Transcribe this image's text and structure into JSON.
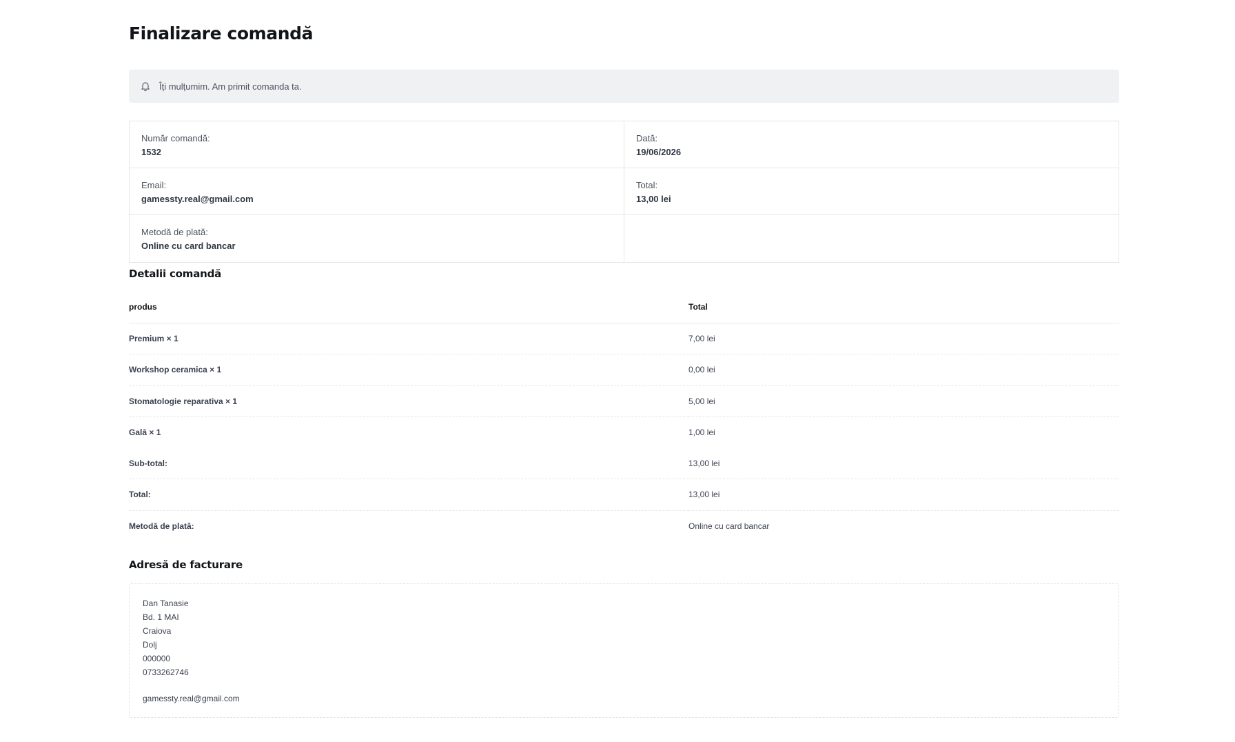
{
  "page": {
    "title": "Finalizare comandă"
  },
  "notice": {
    "icon": "bell-icon",
    "text": "Îți mulțumim. Am primit comanda ta."
  },
  "overview": {
    "order_number_label": "Număr comandă:",
    "order_number": "1532",
    "date_label": "Dată:",
    "date": "19/06/2026",
    "email_label": "Email:",
    "email": "gamessty.real@gmail.com",
    "total_label": "Total:",
    "total": "13,00 lei",
    "payment_label": "Metodă de plată:",
    "payment": "Online cu card bancar"
  },
  "details": {
    "title": "Detalii comandă",
    "header": {
      "product": "produs",
      "total": "Total"
    },
    "items": [
      {
        "name": "Premium × 1",
        "total": "7,00 lei"
      },
      {
        "name": "Workshop ceramica × 1",
        "total": "0,00 lei"
      },
      {
        "name": "Stomatologie reparativa × 1",
        "total": "5,00 lei"
      },
      {
        "name": "Galā × 1",
        "total": "1,00 lei"
      }
    ],
    "subtotal_label": "Sub-total:",
    "subtotal": "13,00 lei",
    "total_label": "Total:",
    "total": "13,00 lei",
    "payment_label": "Metodă de plată:",
    "payment": "Online cu card bancar"
  },
  "billing": {
    "title": "Adresă de facturare",
    "name": "Dan Tanasie",
    "street": "Bd. 1 MAI",
    "city": "Craiova",
    "county": "Dolj",
    "postcode": "000000",
    "phone": "0733262746",
    "email": "gamessty.real@gmail.com"
  }
}
